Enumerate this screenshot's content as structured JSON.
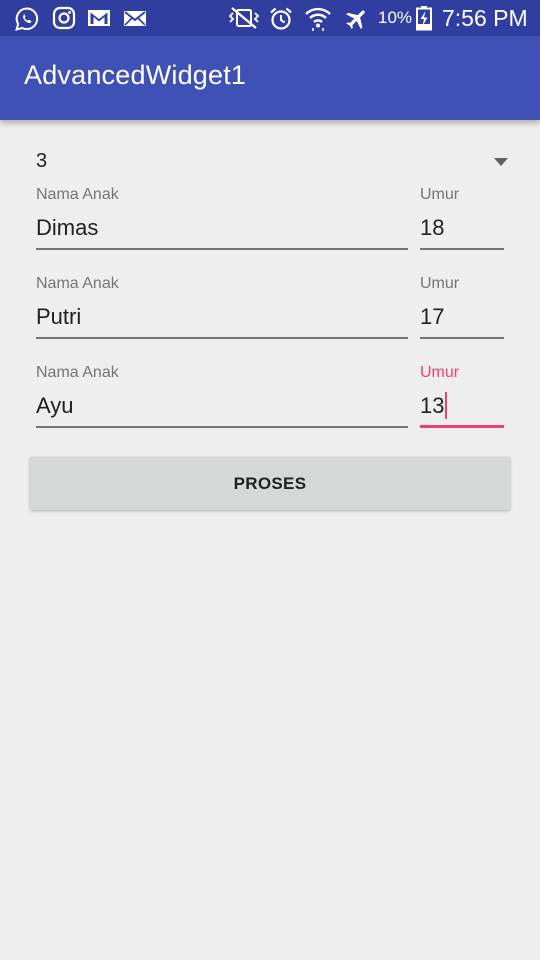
{
  "status_bar": {
    "battery_percent": "10%",
    "time": "7:56 PM",
    "icons": [
      "whatsapp-icon",
      "instagram-icon",
      "gmail-icon",
      "mail-icon",
      "vibrate-off-icon",
      "alarm-icon",
      "wifi-icon",
      "airplane-mode-icon",
      "battery-charging-icon"
    ]
  },
  "app_bar": {
    "title": "AdvancedWidget1"
  },
  "spinner": {
    "selected_value": "3"
  },
  "children": [
    {
      "name_label": "Nama Anak",
      "name_value": "Dimas",
      "age_label": "Umur",
      "age_value": "18"
    },
    {
      "name_label": "Nama Anak",
      "name_value": "Putri",
      "age_label": "Umur",
      "age_value": "17"
    },
    {
      "name_label": "Nama Anak",
      "name_value": "Ayu",
      "age_label": "Umur",
      "age_value": "13"
    }
  ],
  "button": {
    "label": "PROSES"
  },
  "colors": {
    "status_bar": "#303f9f",
    "app_bar": "#3f51b5",
    "accent": "#ec407a",
    "background": "#eeeeee",
    "button": "#d6d7d7"
  }
}
